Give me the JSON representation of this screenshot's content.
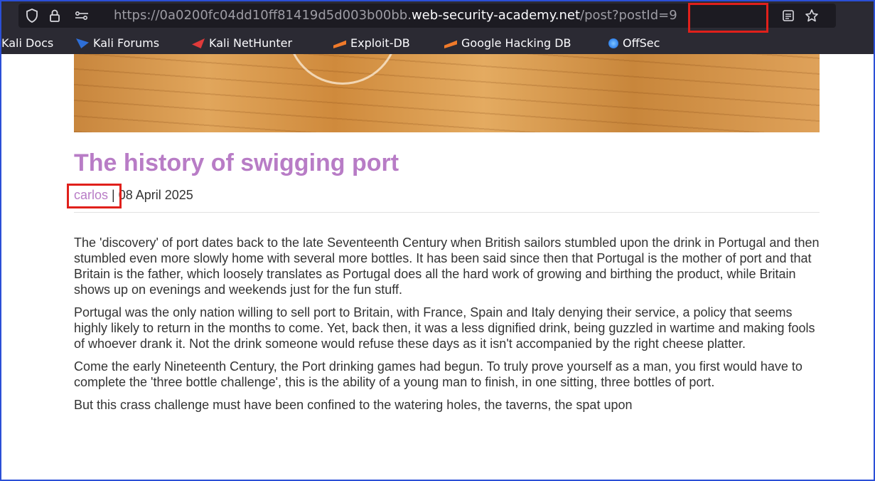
{
  "browser": {
    "url_prefix": "https://0a0200fc04dd10ff81419d5d003b00bb.",
    "url_host": "web-security-academy.net",
    "url_path": "/post",
    "url_query": "?postId=9"
  },
  "bookmarks": [
    {
      "label": "Kali Docs",
      "color": "#2e6fd8"
    },
    {
      "label": "Kali Forums",
      "color": "#2e6fd8"
    },
    {
      "label": "Kali NetHunter",
      "color": "#e03a3a"
    },
    {
      "label": "Exploit-DB",
      "color": "#f07a2a"
    },
    {
      "label": "Google Hacking DB",
      "color": "#f07a2a"
    },
    {
      "label": "OffSec",
      "color": "#3b8cf0"
    }
  ],
  "post": {
    "title": "The history of swigging port",
    "author": "carlos",
    "separator": "|",
    "date": "08 April 2025",
    "paragraphs": [
      "The 'discovery' of port dates back to the late Seventeenth Century when British sailors stumbled upon the drink in Portugal and then stumbled even more slowly home with several more bottles. It has been said since then that Portugal is the mother of port and that Britain is the father, which loosely translates as Portugal does all the hard work of growing and birthing the product, while Britain shows up on evenings and weekends just for the fun stuff.",
      "Portugal was the only nation willing to sell port to Britain, with France, Spain and Italy denying their service, a policy that seems highly likely to return in the months to come. Yet, back then, it was a less dignified drink, being guzzled in wartime and making fools of whoever drank it. Not the drink someone would refuse these days as it isn't accompanied by the right cheese platter.",
      "Come the early Nineteenth Century, the Port drinking games had begun. To truly prove yourself as a man, you first would have to complete the 'three bottle challenge', this is the ability of a young man to finish, in one sitting, three bottles of port.",
      "But this crass challenge must have been confined to the watering holes, the taverns, the spat upon"
    ]
  },
  "colors": {
    "chrome": "#2b2a33",
    "urlbar": "#1c1b22",
    "title": "#b87cc6",
    "highlight": "#e0201b",
    "frame": "#2b4fd6"
  }
}
